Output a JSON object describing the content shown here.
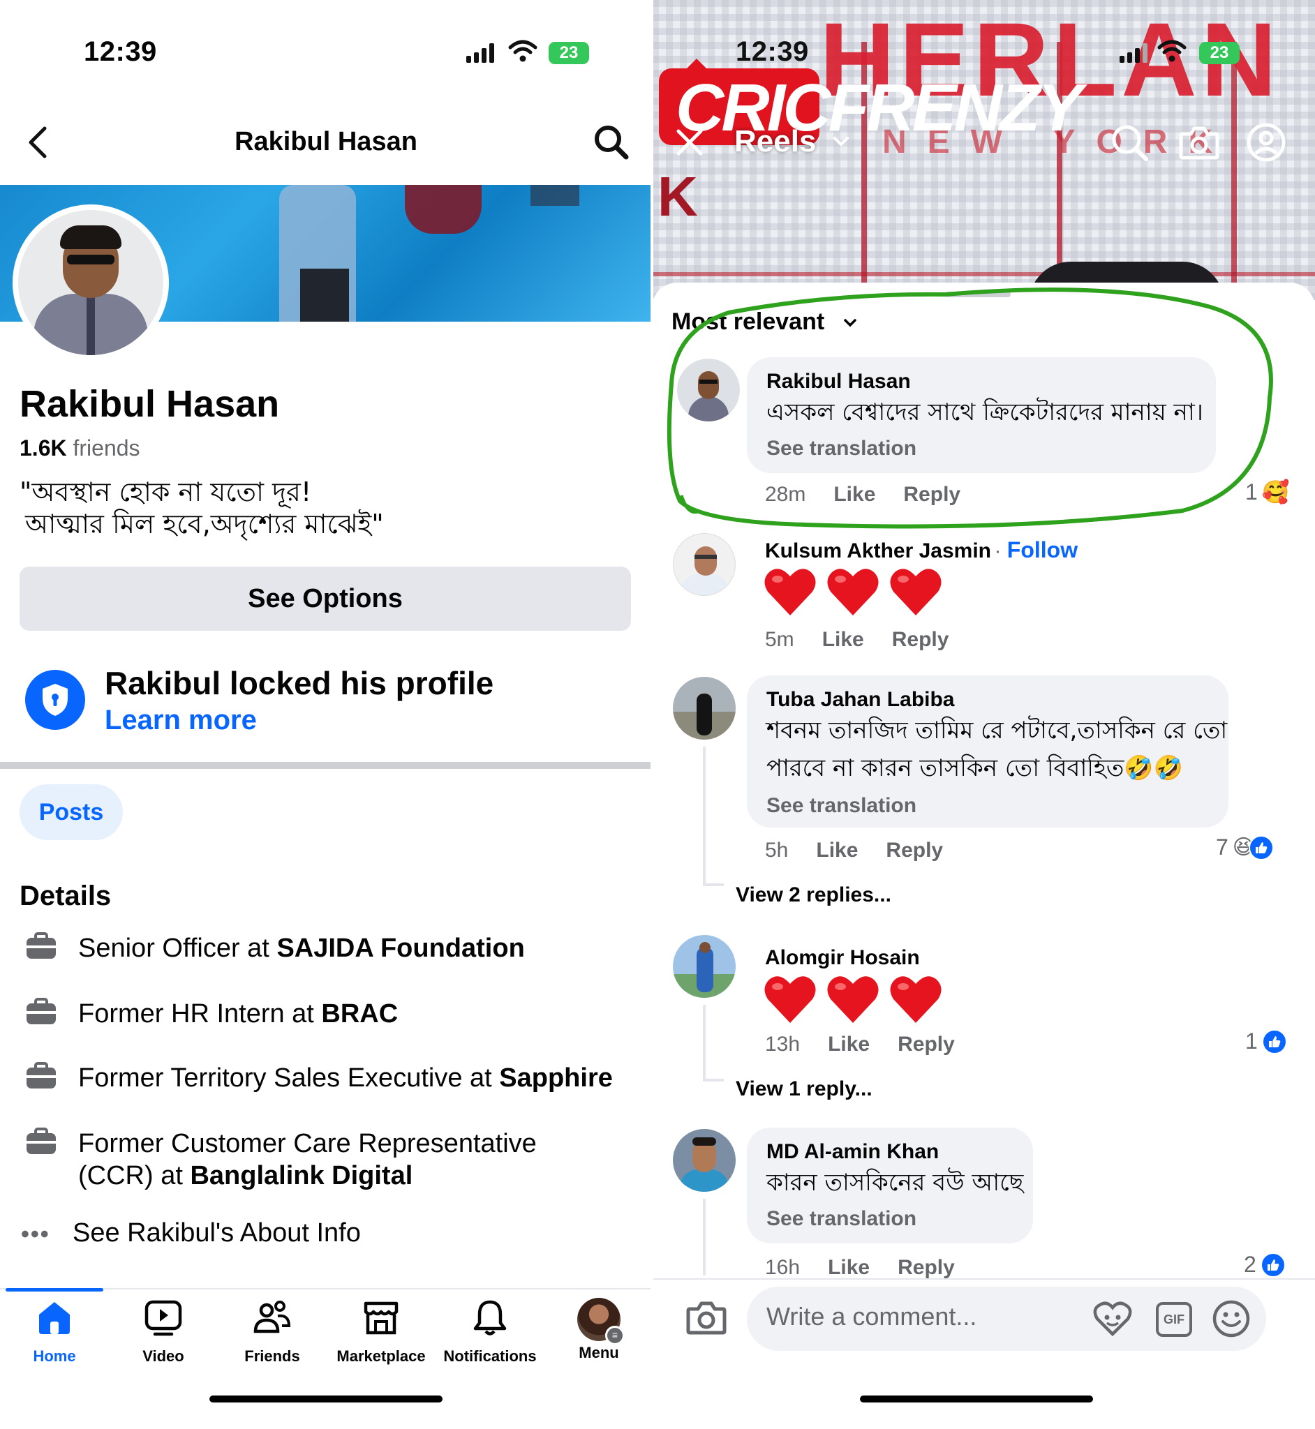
{
  "left": {
    "status": {
      "time": "12:39",
      "battery": "23"
    },
    "nav": {
      "title": "Rakibul Hasan"
    },
    "profile": {
      "name": "Rakibul Hasan",
      "friends_count": "1.6K",
      "friends_label": "friends",
      "bio_line1": "\"অবস্থান হোক না যতো দূর!",
      "bio_line2": "আত্মার মিল হবে,অদৃশ্যের মাঝেই\""
    },
    "see_options": "See Options",
    "lock": {
      "title": "Rakibul locked his profile",
      "link": "Learn more"
    },
    "posts_tab": "Posts",
    "details": {
      "heading": "Details",
      "items": [
        {
          "prefix": "Senior Officer at ",
          "org": "SAJIDA Foundation"
        },
        {
          "prefix": "Former HR Intern at ",
          "org": "BRAC"
        },
        {
          "prefix": "Former Territory Sales Executive at ",
          "org": "Sapphire"
        },
        {
          "prefix_line1": "Former Customer Care Representative",
          "prefix_line2": "(CCR) at ",
          "org": "Banglalink Digital"
        }
      ],
      "about": "See Rakibul's About Info"
    },
    "tabbar": [
      {
        "label": "Home",
        "icon": "home-icon"
      },
      {
        "label": "Video",
        "icon": "video-icon"
      },
      {
        "label": "Friends",
        "icon": "friends-icon"
      },
      {
        "label": "Marketplace",
        "icon": "marketplace-icon"
      },
      {
        "label": "Notifications",
        "icon": "bell-icon"
      },
      {
        "label": "Menu",
        "icon": "avatar-menu-icon"
      }
    ]
  },
  "right": {
    "status": {
      "time": "12:39",
      "battery": "23"
    },
    "reels": {
      "label": "Reels",
      "banner": "CRICFRENZY",
      "banner_bg": "HERLAN",
      "banner_sub": "NEW YORK"
    },
    "sort": "Most relevant",
    "comments": [
      {
        "name": "Rakibul Hasan",
        "text": "এসকল বেশ্বাদের সাথে ক্রিকেটারদের মানায় না।",
        "see_translation": "See translation",
        "time": "28m",
        "like": "Like",
        "reply": "Reply",
        "reaction_count": "1"
      },
      {
        "name": "Kulsum Akther Jasmin",
        "follow": "Follow",
        "time": "5m",
        "like": "Like",
        "reply": "Reply"
      },
      {
        "name": "Tuba Jahan Labiba",
        "text_line1": "শবনম তানজিদ তামিম রে পটাবে,তাসকিন রে তো",
        "text_line2": "পারবে না কারন তাসকিন তো বিবাহিত🤣🤣",
        "see_translation": "See translation",
        "time": "5h",
        "like": "Like",
        "reply": "Reply",
        "reaction_count": "7",
        "view_replies": "View 2 replies..."
      },
      {
        "name": "Alomgir Hosain",
        "time": "13h",
        "like": "Like",
        "reply": "Reply",
        "reaction_count": "1",
        "view_replies": "View 1 reply..."
      },
      {
        "name": "MD Al-amin Khan",
        "text": "কারন তাসকিনের বউ আছে",
        "see_translation": "See translation",
        "time": "16h",
        "like": "Like",
        "reply": "Reply",
        "reaction_count": "2"
      }
    ],
    "composer": {
      "placeholder": "Write a comment..."
    },
    "colors": {
      "accent": "#0866ff",
      "circle": "#2ea21c",
      "banner_red": "#e0131f"
    }
  }
}
